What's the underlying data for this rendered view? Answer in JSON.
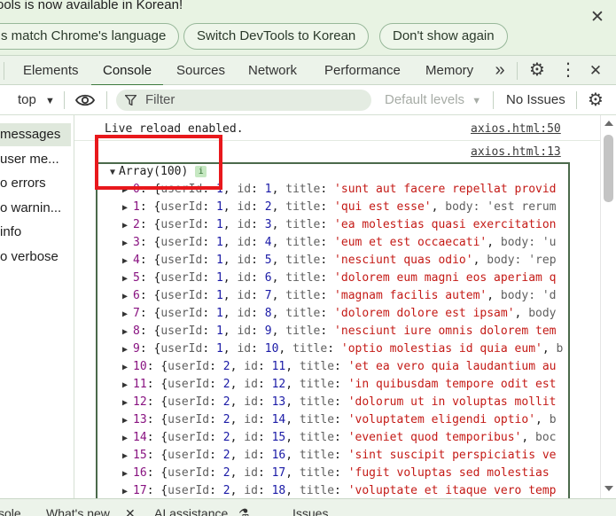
{
  "infobar": {
    "message": "ools is now available in Korean!",
    "buttons": [
      "s match Chrome's language",
      "Switch DevTools to Korean",
      "Don't show again"
    ],
    "close_icon": "close-icon"
  },
  "tabs": {
    "items": [
      "Elements",
      "Console",
      "Sources",
      "Network",
      "Performance",
      "Memory"
    ],
    "active": "Console",
    "more_glyph": "»",
    "settings_glyph": "⚙",
    "menu_glyph": "⋮",
    "close_glyph": "✕"
  },
  "toolbar": {
    "context": "top",
    "context_arrow": "▼",
    "eye_glyph": "👁",
    "filter_icon": "⏷",
    "filter_placeholder": "Filter",
    "levels": "Default levels",
    "levels_arrow": "▼",
    "issues": "No Issues",
    "settings_glyph": "⚙"
  },
  "sidebar": {
    "items": [
      "messages",
      "user me...",
      "o errors",
      "o warnin...",
      "info",
      "o verbose"
    ],
    "selected": "messages"
  },
  "console": {
    "messages": [
      {
        "text": "Live reload enabled.",
        "source": "axios.html:50"
      },
      {
        "text": "",
        "source": "axios.html:13"
      }
    ],
    "array_label": "Array(100)",
    "array_expand": "▼",
    "badge": "i",
    "row_expand": "▶",
    "rows": [
      {
        "index": "0",
        "userId": "1",
        "id": "1",
        "title": "'sunt aut facere repellat provid",
        "rest": ""
      },
      {
        "index": "1",
        "userId": "1",
        "id": "2",
        "title": "'qui est esse'",
        "rest": "body: 'est rerum"
      },
      {
        "index": "2",
        "userId": "1",
        "id": "3",
        "title": "'ea molestias quasi exercitation",
        "rest": ""
      },
      {
        "index": "3",
        "userId": "1",
        "id": "4",
        "title": "'eum et est occaecati'",
        "rest": "body: 'u"
      },
      {
        "index": "4",
        "userId": "1",
        "id": "5",
        "title": "'nesciunt quas odio'",
        "rest": "body: 'rep"
      },
      {
        "index": "5",
        "userId": "1",
        "id": "6",
        "title": "'dolorem eum magni eos aperiam q",
        "rest": ""
      },
      {
        "index": "6",
        "userId": "1",
        "id": "7",
        "title": "'magnam facilis autem'",
        "rest": "body: 'd"
      },
      {
        "index": "7",
        "userId": "1",
        "id": "8",
        "title": "'dolorem dolore est ipsam'",
        "rest": "body"
      },
      {
        "index": "8",
        "userId": "1",
        "id": "9",
        "title": "'nesciunt iure omnis dolorem tem",
        "rest": ""
      },
      {
        "index": "9",
        "userId": "1",
        "id": "10",
        "title": "'optio molestias id quia eum'",
        "rest": "b"
      },
      {
        "index": "10",
        "userId": "2",
        "id": "11",
        "title": "'et ea vero quia laudantium au",
        "rest": ""
      },
      {
        "index": "11",
        "userId": "2",
        "id": "12",
        "title": "'in quibusdam tempore odit est",
        "rest": ""
      },
      {
        "index": "12",
        "userId": "2",
        "id": "13",
        "title": "'dolorum ut in voluptas mollit",
        "rest": ""
      },
      {
        "index": "13",
        "userId": "2",
        "id": "14",
        "title": "'voluptatem eligendi optio'",
        "rest": "b"
      },
      {
        "index": "14",
        "userId": "2",
        "id": "15",
        "title": "'eveniet quod temporibus'",
        "rest": "boc"
      },
      {
        "index": "15",
        "userId": "2",
        "id": "16",
        "title": "'sint suscipit perspiciatis ve",
        "rest": ""
      },
      {
        "index": "16",
        "userId": "2",
        "id": "17",
        "title": "'fugit voluptas sed molestias",
        "rest": ""
      },
      {
        "index": "17",
        "userId": "2",
        "id": "18",
        "title": "'voluptate et itaque vero temp",
        "rest": ""
      }
    ]
  },
  "drawer": {
    "tabs": [
      "sole",
      "What's new",
      "AI assistance",
      "Issues"
    ],
    "close_glyph": "✕",
    "ai_glyph": "⚗"
  }
}
